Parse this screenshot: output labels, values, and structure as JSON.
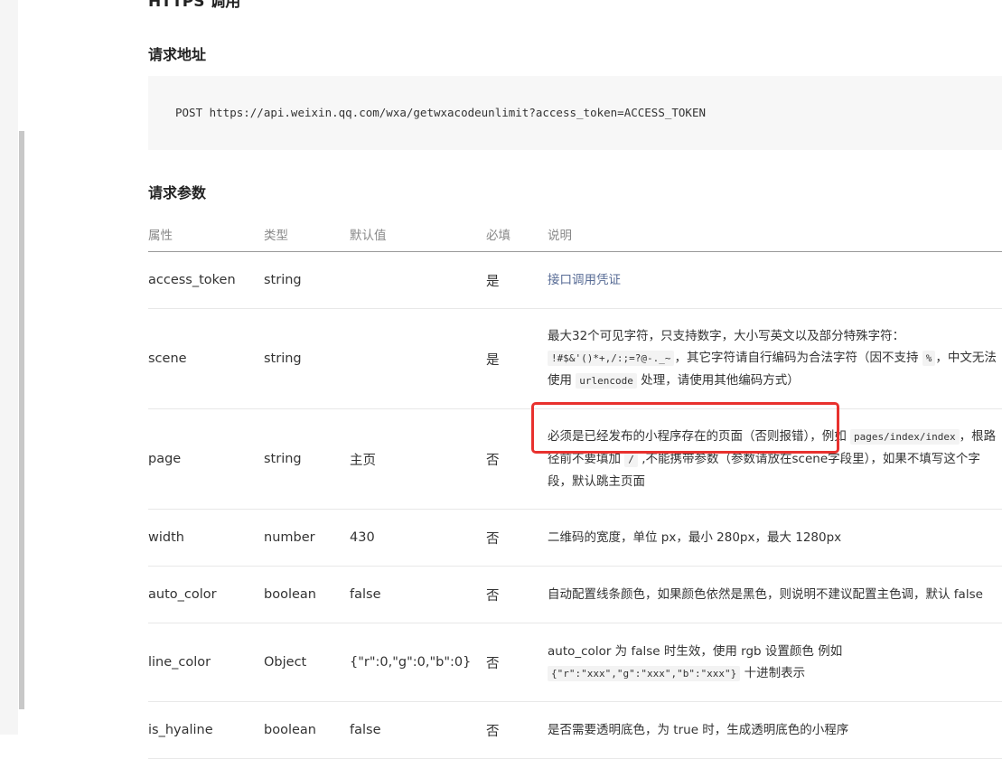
{
  "doc": {
    "cut_heading": "HTTPS 调用",
    "request_url_title": "请求地址",
    "request_url": "POST https://api.weixin.qq.com/wxa/getwxacodeunlimit?access_token=ACCESS_TOKEN",
    "params_title": "请求参数"
  },
  "table": {
    "headers": [
      "属性",
      "类型",
      "默认值",
      "必填",
      "说明"
    ],
    "rows": [
      {
        "name": "access_token",
        "type": "string",
        "default": "",
        "required": "是",
        "desc_link": "接口调用凭证"
      },
      {
        "name": "scene",
        "type": "string",
        "default": "",
        "required": "是",
        "desc_line1": "最大32个可见字符，只支持数字，大小写英文以及部分特殊字符：",
        "desc_code1": "!#$&'()*+,/:;=?@-._~",
        "desc_line2_text": "，其它字符请自行编码为合法字符（因不支持",
        "desc_code2": "%",
        "desc_line2_tail": "，中文无法",
        "desc_line3_pre": "使用",
        "desc_code3": "urlencode",
        "desc_line3_post": "处理，请使用其他编码方式）"
      },
      {
        "name": "page",
        "type": "string",
        "default": "主页",
        "required": "否",
        "desc_line1": "必须是已经发布的小程序存在的页面（否则报错），例如",
        "desc_code1": "pages/index/index",
        "desc_line1_tail": "，根路",
        "desc_line2_pre": "径前不要填加",
        "desc_code2": "/",
        "desc_line2_post": ",不能携带参数（参数请放在scene字段里），如果不填写这个字",
        "desc_line3": "段，默认跳主页面"
      },
      {
        "name": "width",
        "type": "number",
        "default": "430",
        "required": "否",
        "desc": "二维码的宽度，单位 px，最小 280px，最大 1280px"
      },
      {
        "name": "auto_color",
        "type": "boolean",
        "default": "false",
        "required": "否",
        "desc": "自动配置线条颜色，如果颜色依然是黑色，则说明不建议配置主色调，默认 false"
      },
      {
        "name": "line_color",
        "type": "Object",
        "default": "{\"r\":0,\"g\":0,\"b\":0}",
        "required": "否",
        "desc_line1": "auto_color 为 false 时生效，使用 rgb 设置颜色 例如",
        "desc_code1": "{\"r\":\"xxx\",\"g\":\"xxx\",\"b\":\"xxx\"}",
        "desc_line2_post": "十进制表示"
      },
      {
        "name": "is_hyaline",
        "type": "boolean",
        "default": "false",
        "required": "否",
        "desc": "是否需要透明底色，为 true 时，生成透明底色的小程序"
      }
    ]
  },
  "colors": {
    "link": "#576b95",
    "highlight_border": "#e8312e",
    "code_bg": "#f7f7f7"
  }
}
